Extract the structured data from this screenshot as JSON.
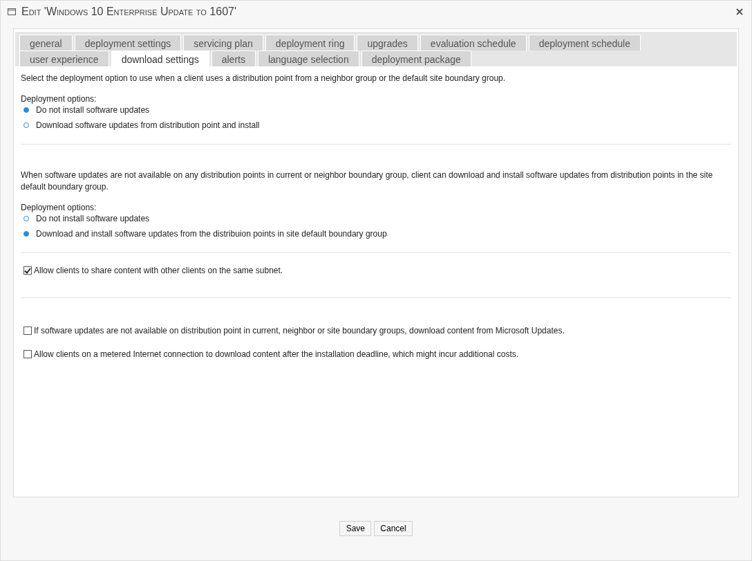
{
  "window": {
    "title": "Edit 'Windows 10 Enterprise Update to 1607'"
  },
  "tab_rows": [
    [
      {
        "label": "general",
        "selected": false
      },
      {
        "label": "deployment settings",
        "selected": false
      },
      {
        "label": "servicing plan",
        "selected": false
      },
      {
        "label": "deployment ring",
        "selected": false
      },
      {
        "label": "upgrades",
        "selected": false
      },
      {
        "label": "evaluation schedule",
        "selected": false
      },
      {
        "label": "deployment schedule",
        "selected": false
      }
    ],
    [
      {
        "label": "user experience",
        "selected": false
      },
      {
        "label": "download settings",
        "selected": true
      },
      {
        "label": "alerts",
        "selected": false
      },
      {
        "label": "language selection",
        "selected": false
      },
      {
        "label": "deployment package",
        "selected": false
      }
    ]
  ],
  "sections": [
    {
      "kind": "radio",
      "text": "Select the deployment option to use when a client uses a distribution point from a neighbor group or the default site boundary group.",
      "label": "Deployment options:",
      "options": [
        {
          "label": "Do not install software updates",
          "selected": true
        },
        {
          "label": "Download software updates from distribution point and install",
          "selected": false
        }
      ]
    },
    {
      "kind": "radio",
      "text": "When software updates are not available on any distribution points in current or neighbor boundary group, client can download and install software updates from distribution points in the site default boundary group.",
      "label": "Deployment options:",
      "options": [
        {
          "label": "Do not install software updates",
          "selected": false
        },
        {
          "label": "Download and install software updates from the distribuion points in site default boundary group",
          "selected": true
        }
      ]
    },
    {
      "kind": "checkbox",
      "items": [
        {
          "label": "Allow clients to share content with other clients on the same subnet.",
          "checked": true
        }
      ]
    },
    {
      "kind": "checkbox",
      "items": [
        {
          "label": "If software updates are not available on distribution point in current, neighbor or site boundary groups, download content from Microsoft Updates.",
          "checked": false
        },
        {
          "label": "Allow clients on a metered Internet connection to download content after the installation deadline, which might incur additional costs.",
          "checked": false
        }
      ]
    }
  ],
  "buttons": [
    "Save",
    "Cancel"
  ]
}
